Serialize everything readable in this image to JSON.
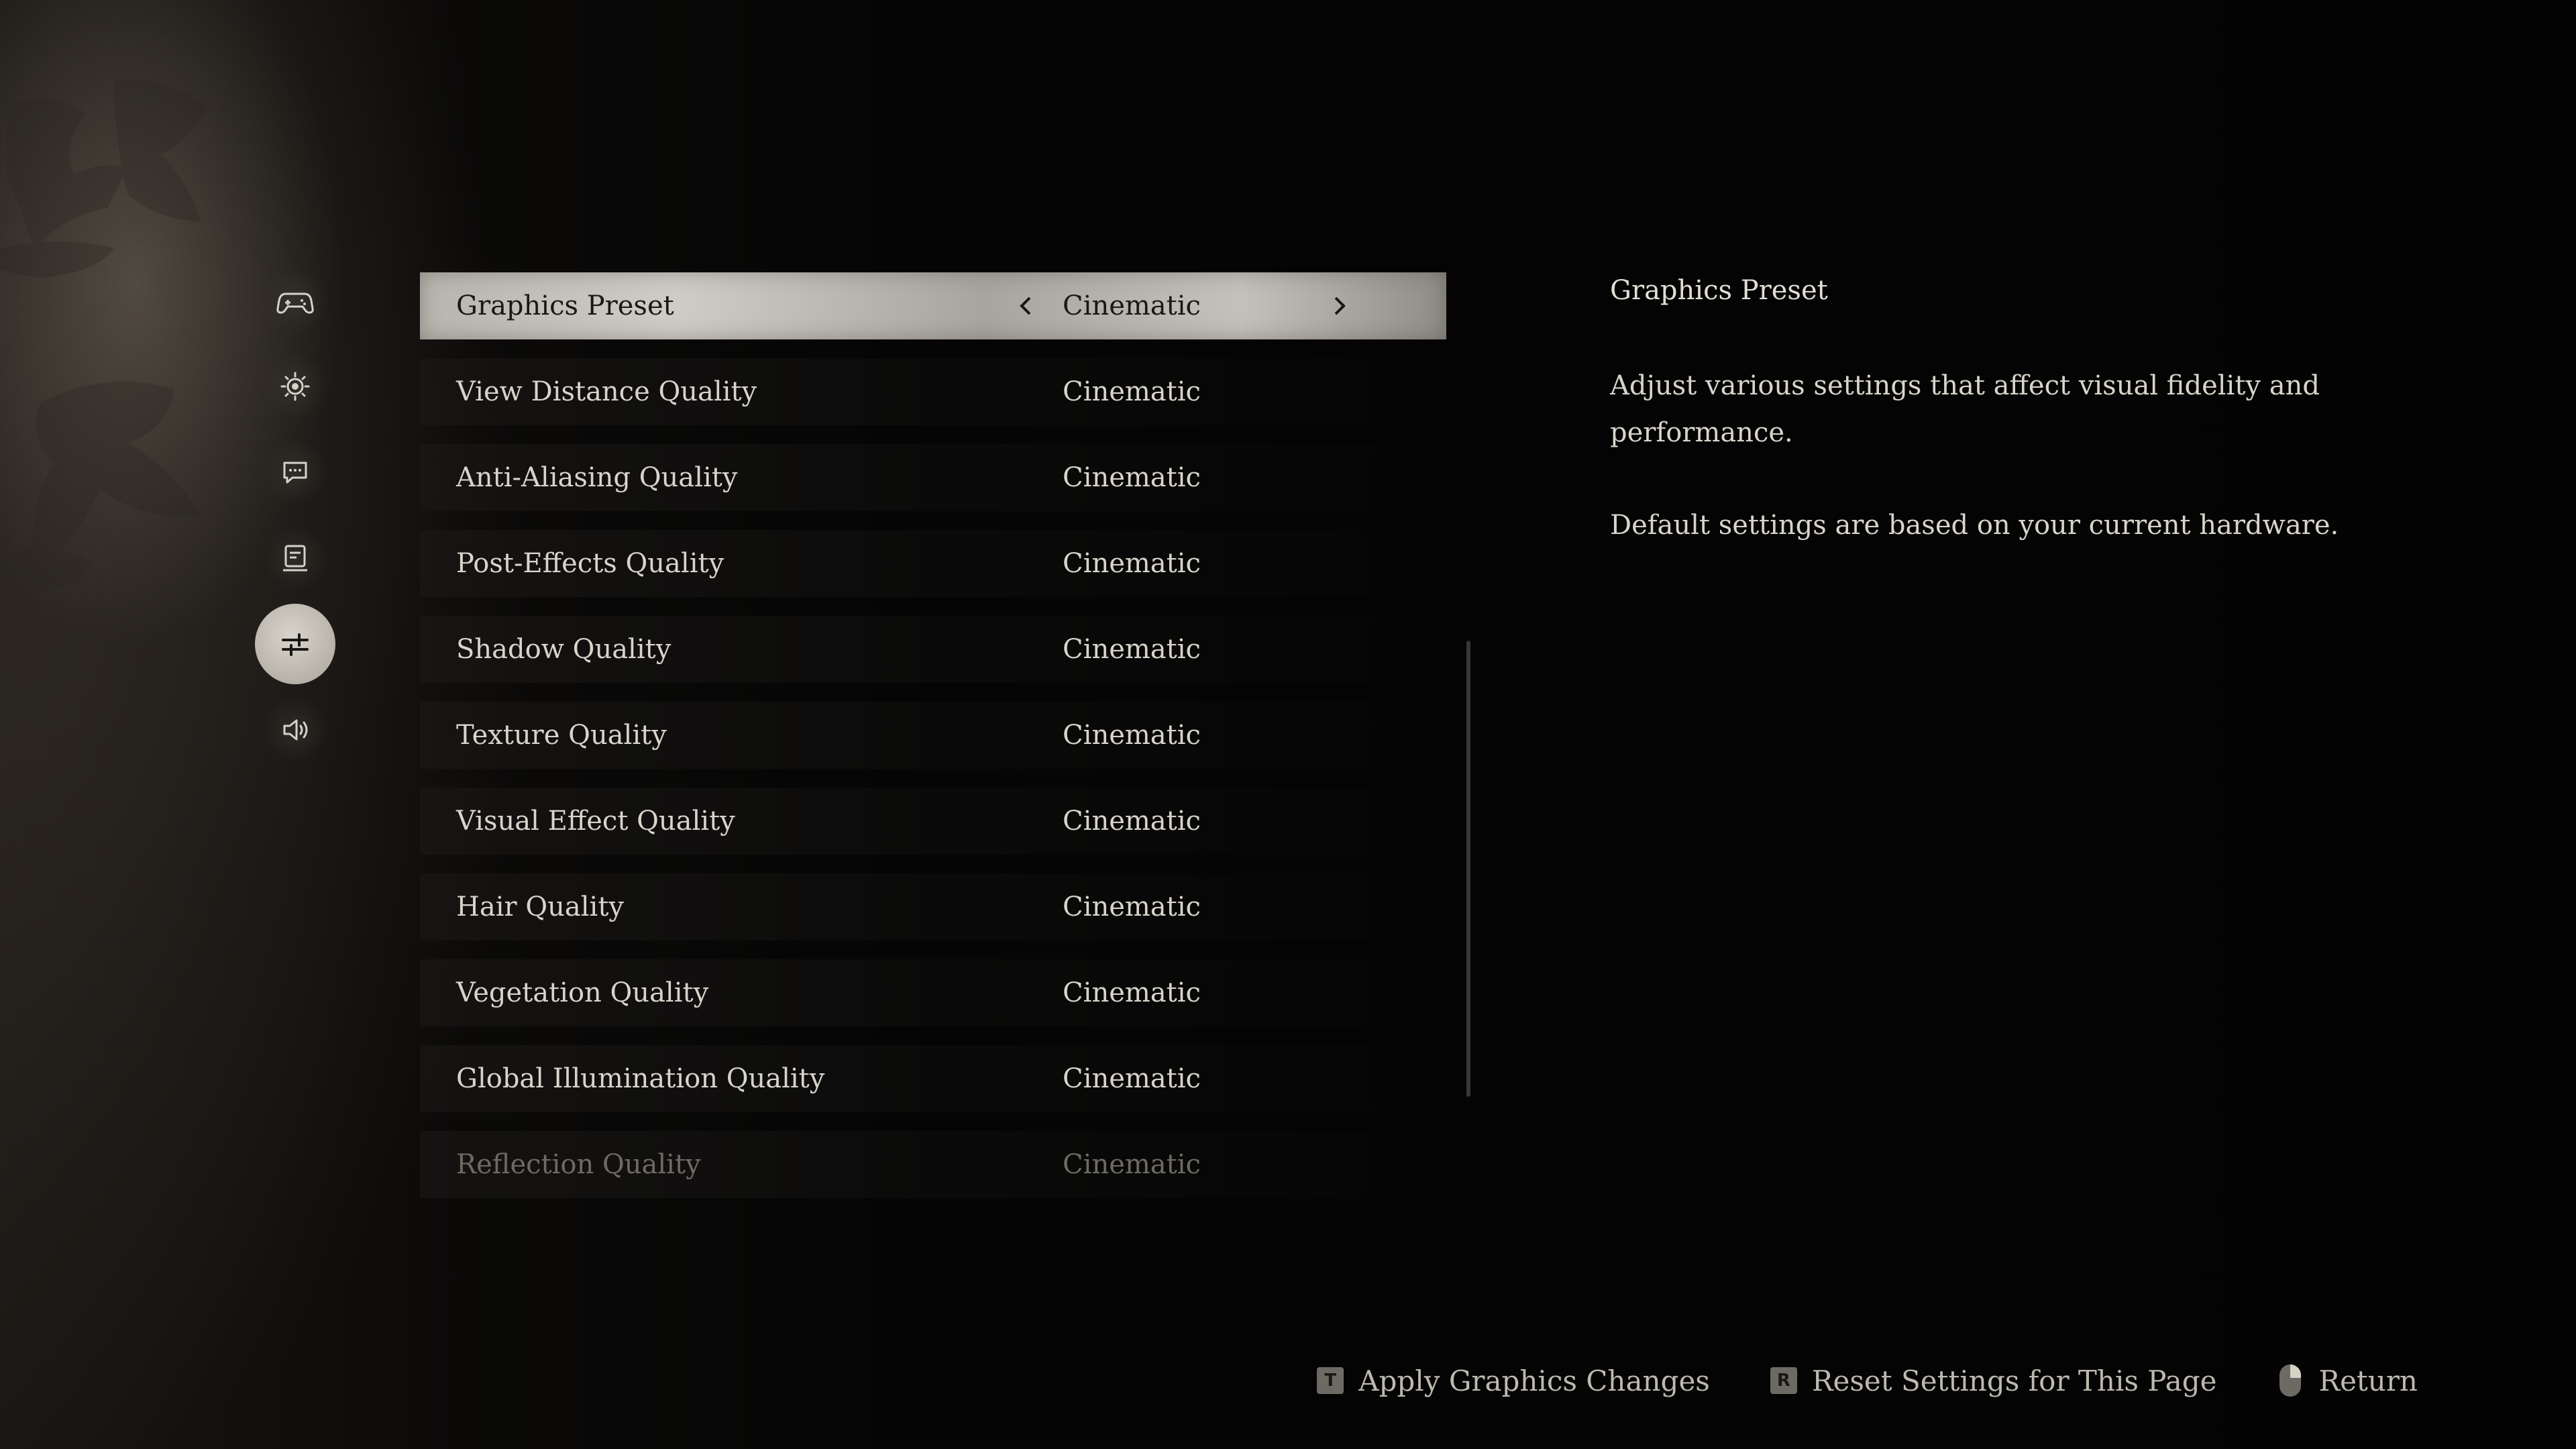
{
  "sidebar": {
    "items": [
      {
        "icon": "gamepad-icon",
        "active": false
      },
      {
        "icon": "brightness-icon",
        "active": false
      },
      {
        "icon": "chat-icon",
        "active": false
      },
      {
        "icon": "display-icon",
        "active": false
      },
      {
        "icon": "sliders-icon",
        "active": true
      },
      {
        "icon": "speaker-icon",
        "active": false
      }
    ]
  },
  "settings": {
    "rows": [
      {
        "label": "Graphics Preset",
        "value": "Cinematic"
      },
      {
        "label": "View Distance Quality",
        "value": "Cinematic"
      },
      {
        "label": "Anti-Aliasing Quality",
        "value": "Cinematic"
      },
      {
        "label": "Post-Effects Quality",
        "value": "Cinematic"
      },
      {
        "label": "Shadow Quality",
        "value": "Cinematic"
      },
      {
        "label": "Texture Quality",
        "value": "Cinematic"
      },
      {
        "label": "Visual Effect Quality",
        "value": "Cinematic"
      },
      {
        "label": "Hair Quality",
        "value": "Cinematic"
      },
      {
        "label": "Vegetation Quality",
        "value": "Cinematic"
      },
      {
        "label": "Global Illumination Quality",
        "value": "Cinematic"
      },
      {
        "label": "Reflection Quality",
        "value": "Cinematic"
      }
    ]
  },
  "description": {
    "title": "Graphics Preset",
    "paragraph1": "Adjust various settings that affect visual fidelity and performance.",
    "paragraph2": "Default settings are based on your current hardware."
  },
  "footer": {
    "apply_key": "T",
    "apply_label": "Apply Graphics Changes",
    "reset_key": "R",
    "reset_label": "Reset Settings for This Page",
    "return_label": "Return"
  }
}
